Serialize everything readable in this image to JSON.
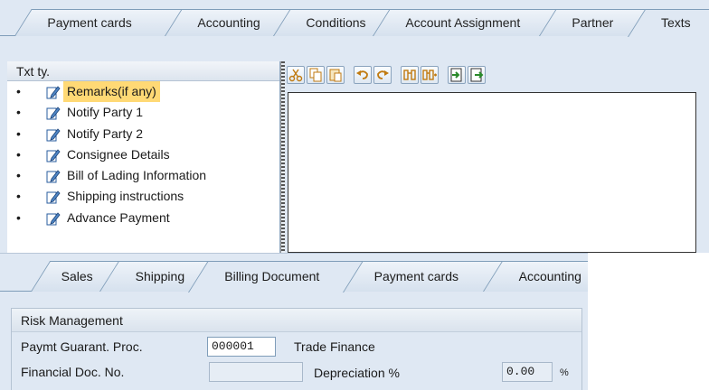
{
  "top_tabs": [
    "Payment cards",
    "Accounting",
    "Conditions",
    "Account Assignment",
    "Partner",
    "Texts"
  ],
  "active_top_tab": "Texts",
  "text_tree": {
    "header": "Txt ty.",
    "items": [
      {
        "label": "Remarks(if any)",
        "selected": true
      },
      {
        "label": "Notify Party 1",
        "selected": false
      },
      {
        "label": "Notify Party 2",
        "selected": false
      },
      {
        "label": "Consignee Details",
        "selected": false
      },
      {
        "label": "Bill of Lading Information",
        "selected": false
      },
      {
        "label": "Shipping instructions",
        "selected": false
      },
      {
        "label": "Advance Payment",
        "selected": false
      }
    ]
  },
  "editor_toolbar": {
    "buttons": [
      "cut-icon",
      "copy-icon",
      "paste-icon",
      "undo-icon",
      "redo-icon",
      "find-icon",
      "find-next-icon",
      "import-icon",
      "export-icon"
    ]
  },
  "bottom_tabs": [
    "Sales",
    "Shipping",
    "Billing Document",
    "Payment cards",
    "Accounting"
  ],
  "active_bottom_tab": "Billing Document",
  "risk_management": {
    "title": "Risk Management",
    "payment_guarantee": {
      "label": "Paymt Guarant. Proc.",
      "value": "000001",
      "description": "Trade Finance"
    },
    "financial_doc": {
      "label": "Financial Doc. No.",
      "value": ""
    },
    "depreciation": {
      "label": "Depreciation %",
      "value": "0.00",
      "unit": "%"
    }
  },
  "colors": {
    "background": "#dfe8f3",
    "selection": "#ffd975",
    "border": "#7f9db9"
  }
}
